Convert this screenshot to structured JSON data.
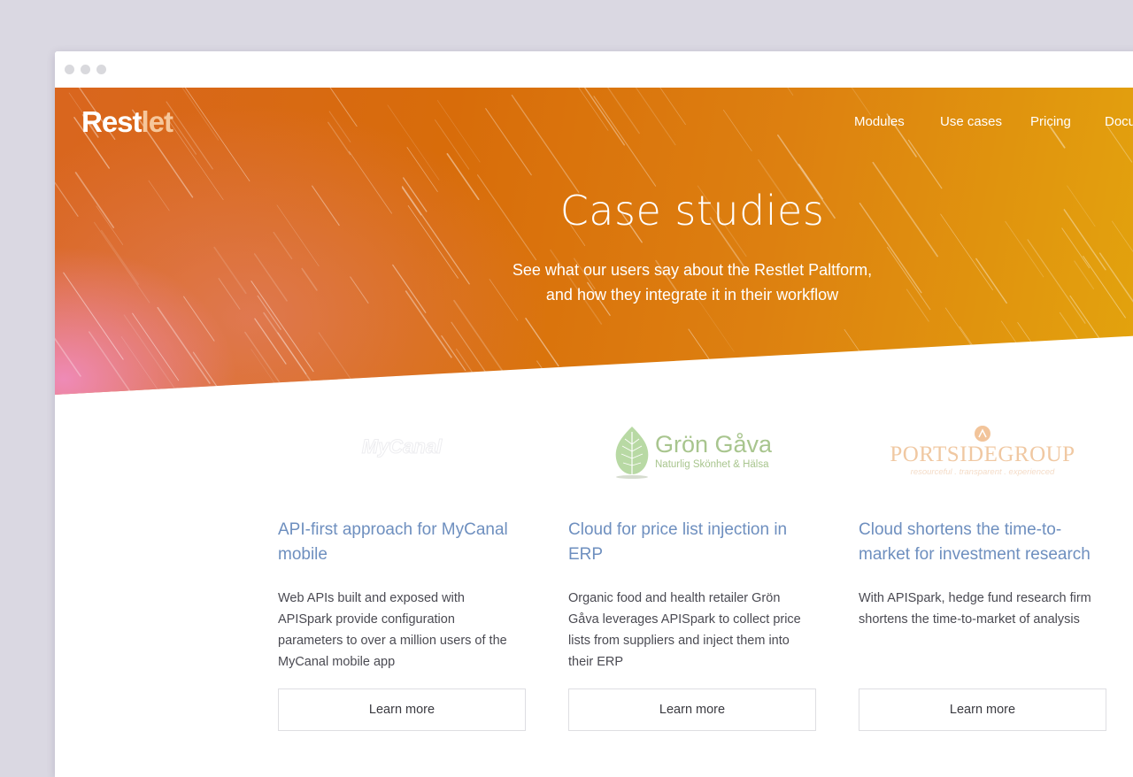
{
  "brand": {
    "part1": "Rest",
    "part2": "let"
  },
  "nav": [
    {
      "label": "Modules"
    },
    {
      "label": "Use cases"
    },
    {
      "label": "Pricing"
    },
    {
      "label": "Docu"
    }
  ],
  "hero": {
    "title": "Case studies",
    "subtitle_line1": "See what our users say about the Restlet Paltform,",
    "subtitle_line2": "and how they integrate it in their workflow"
  },
  "cases": [
    {
      "logo_text": "MyCanal",
      "title": "API-first approach for MyCanal mobile",
      "description": "Web APIs built and exposed with APISpark provide configuration parameters to over a million users of the MyCanal mobile app",
      "button": "Learn more"
    },
    {
      "logo_name": "Grön Gåva",
      "logo_tagline": "Naturlig Skönhet & Hälsa",
      "title": "Cloud for price list injection in ERP",
      "description": "Organic food and health retailer Grön Gåva leverages APISpark to collect price lists from suppliers and inject them into their ERP",
      "button": "Learn more"
    },
    {
      "logo_name": "PORTSIDEGROUP",
      "logo_tagline": "resourceful . transparent . experienced",
      "title": "Cloud shortens the time-to-market for investment research",
      "description": "With APISpark, hedge fund research firm shortens the time-to-market of analysis",
      "button": "Learn more"
    }
  ],
  "colors": {
    "background": "#dad8e2",
    "hero_orange": "#d86c0a",
    "hero_yellow": "#e3a40d",
    "hero_pink": "#f08cbe",
    "link_blue": "#6e8fbf",
    "text_dark": "#4a4a52"
  }
}
